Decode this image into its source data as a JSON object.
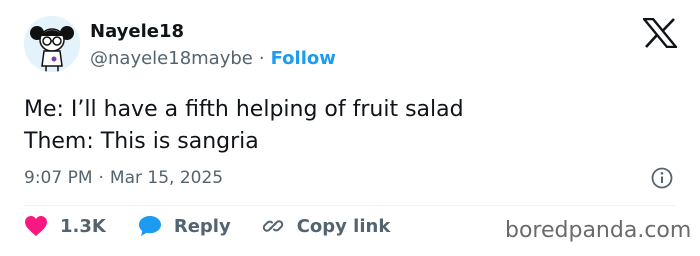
{
  "author": {
    "display_name": "Nayele18",
    "handle": "@nayele18maybe",
    "separator": "·",
    "follow_label": "Follow"
  },
  "tweet": {
    "lines": [
      "Me: I’ll have a fifth helping of fruit salad",
      "Them: This is sangria"
    ],
    "time": "9:07 PM",
    "separator": "·",
    "date": "Mar 15, 2025"
  },
  "actions": {
    "likes_count": "1.3K",
    "reply_label": "Reply",
    "copy_link_label": "Copy link"
  },
  "watermark": "boredpanda.com",
  "colors": {
    "accent": "#1d9bf0",
    "like": "#f91880",
    "text": "#0f1419",
    "muted": "#536471"
  },
  "icons": [
    "x-logo-icon",
    "heart-icon",
    "reply-bubble-icon",
    "link-icon",
    "info-icon"
  ]
}
